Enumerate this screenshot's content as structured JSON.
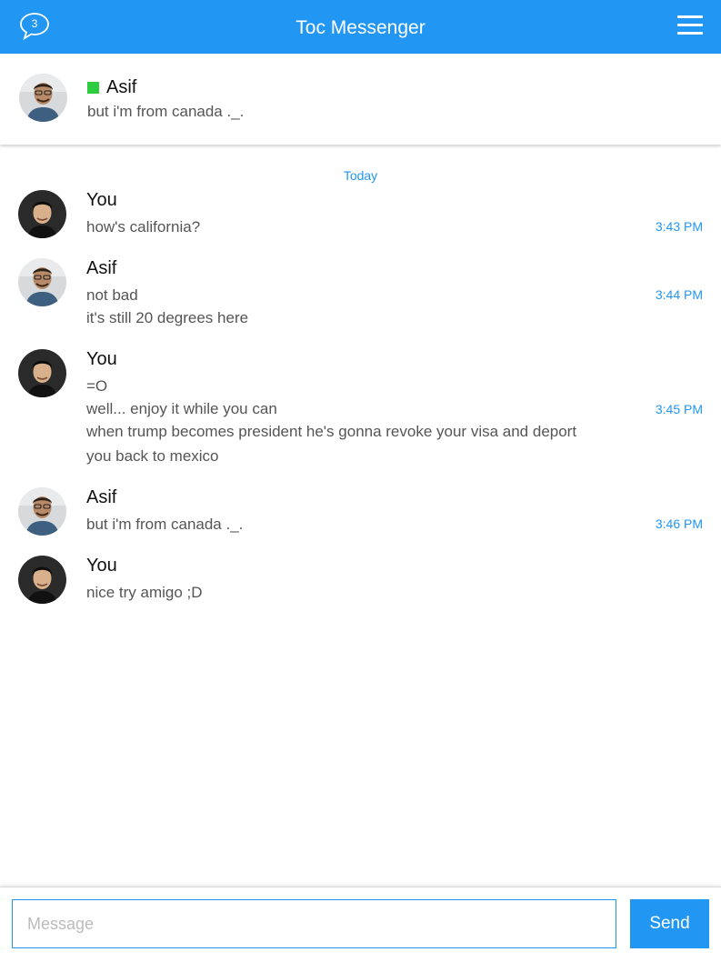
{
  "app": {
    "title": "Toc Messenger",
    "unread_count": "3"
  },
  "colors": {
    "primary": "#2196f3",
    "online": "#2ecc40"
  },
  "icons": {
    "chat": "chat-bubble-icon",
    "menu": "hamburger-menu-icon"
  },
  "contact": {
    "name": "Asif",
    "status": "online",
    "last_message": "but i'm from canada ._."
  },
  "day_separator": "Today",
  "messages": [
    {
      "sender": "You",
      "avatar": "you",
      "lines": [
        "how's california?"
      ],
      "time": "3:43 PM"
    },
    {
      "sender": "Asif",
      "avatar": "asif",
      "lines": [
        "not bad",
        "it's still 20 degrees here"
      ],
      "time": "3:44 PM"
    },
    {
      "sender": "You",
      "avatar": "you",
      "lines": [
        "=O",
        "well... enjoy it while you can",
        "when trump becomes president he's gonna revoke your visa and deport",
        "you back to mexico"
      ],
      "time": "3:45 PM"
    },
    {
      "sender": "Asif",
      "avatar": "asif",
      "lines": [
        "but i'm from canada ._."
      ],
      "time": "3:46 PM"
    },
    {
      "sender": "You",
      "avatar": "you",
      "lines": [
        "nice try amigo ;D"
      ],
      "time": ""
    }
  ],
  "composer": {
    "placeholder": "Message",
    "value": "",
    "send_label": "Send"
  }
}
